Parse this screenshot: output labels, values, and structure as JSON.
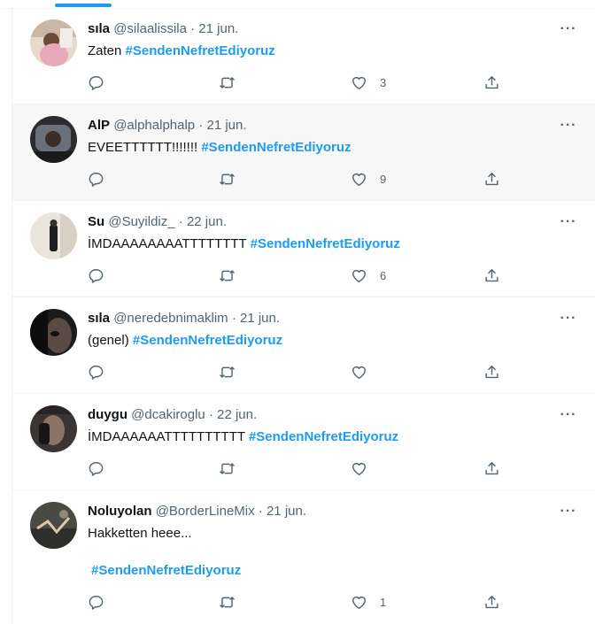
{
  "tweets": [
    {
      "name": "sıla",
      "handle": "@silaalissila",
      "date": "21 jun.",
      "text": "Zaten",
      "hashtag": "#SendenNefretEdiyoruz",
      "likes": "3"
    },
    {
      "name": "AlP",
      "handle": "@alphalphalp",
      "date": "21 jun.",
      "text": "EVEETTTTTT!!!!!!!",
      "hashtag": "#SendenNefretEdiyoruz",
      "likes": "9"
    },
    {
      "name": "Su",
      "handle": "@Suyildiz_",
      "date": "22 jun.",
      "text": "İMDAAAAAAAATTTTTTTT",
      "hashtag": "#SendenNefretEdiyoruz",
      "likes": "6"
    },
    {
      "name": "sıla",
      "handle": "@neredebnimaklim",
      "date": "21 jun.",
      "text": "(genel)",
      "hashtag": "#SendenNefretEdiyoruz",
      "likes": ""
    },
    {
      "name": "duygu",
      "handle": "@dcakiroglu",
      "date": "22 jun.",
      "text": "İMDAAAAAATTTTTTTTTT",
      "hashtag": "#SendenNefretEdiyoruz",
      "likes": ""
    },
    {
      "name": "Noluyolan",
      "handle": "@BorderLineMix",
      "date": "21 jun.",
      "text": "Hakketten heee...",
      "hashtag": "#SendenNefretEdiyoruz",
      "likes": "1"
    }
  ],
  "separator": "·",
  "more_glyph": "···",
  "icons": {
    "reply": "reply-icon",
    "retweet": "retweet-icon",
    "like": "heart-icon",
    "share": "share-icon",
    "more": "more-icon"
  },
  "colors": {
    "accent": "#1d9bf0",
    "text": "#0f1419",
    "muted": "#536471"
  }
}
